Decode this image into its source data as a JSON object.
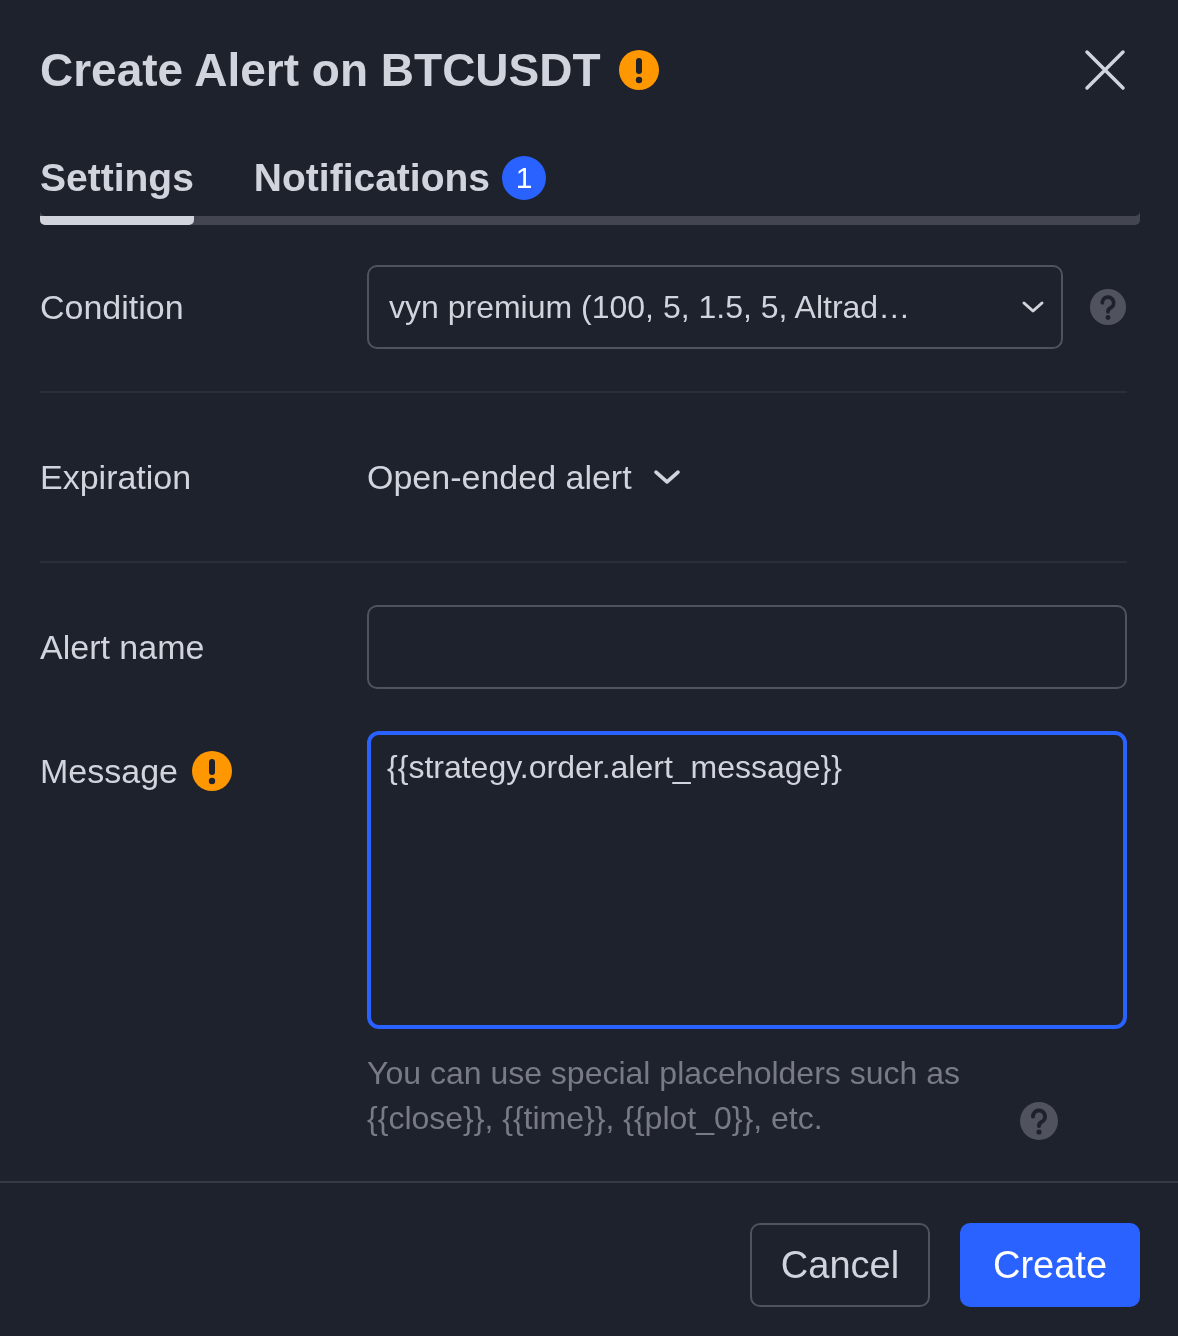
{
  "dialog": {
    "title": "Create Alert on BTCUSDT",
    "title_warning": true
  },
  "tabs": [
    {
      "label": "Settings",
      "selected": true
    },
    {
      "label": "Notifications",
      "selected": false,
      "badge": "1"
    }
  ],
  "fields": [
    {
      "kind": "select",
      "label": "Condition",
      "value": "vyn premium (100, 5, 1.5, 5, Altrad…",
      "help": true
    },
    {
      "kind": "dropdown",
      "label": "Expiration",
      "value": "Open-ended alert"
    },
    {
      "kind": "input",
      "label": "Alert name"
    },
    {
      "kind": "textarea",
      "label": "Message",
      "warning": true,
      "value": "{{strategy.order.alert_message}}",
      "focused": true,
      "hint": "You can use special placeholders such as {{close}}, {{time}}, {{plot_0}}, etc."
    }
  ],
  "buttons": [
    {
      "label": "Cancel",
      "kind": "secondary"
    },
    {
      "label": "Create",
      "kind": "primary"
    }
  ]
}
